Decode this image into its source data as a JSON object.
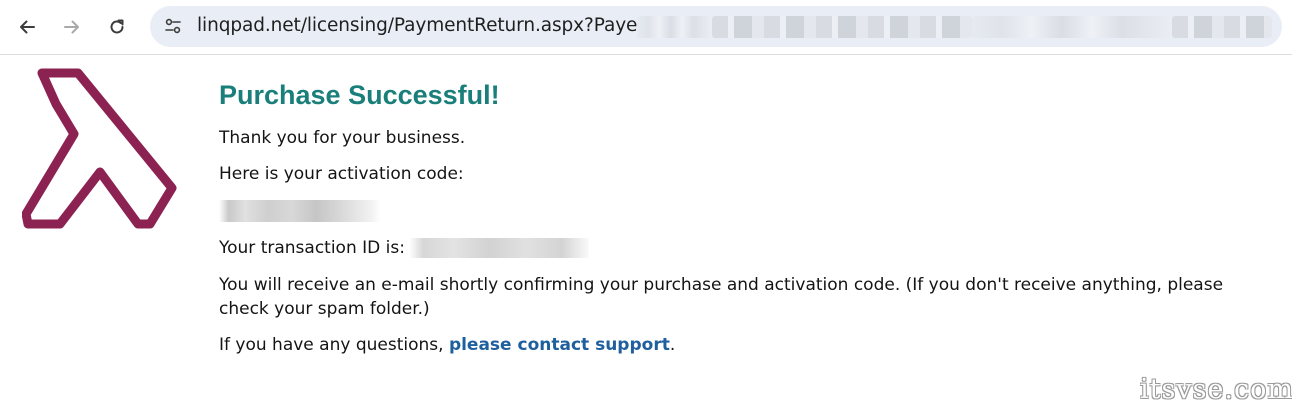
{
  "browser": {
    "back_icon": "arrow-left-icon",
    "forward_icon": "arrow-right-icon",
    "reload_icon": "reload-icon",
    "site_info_icon": "tune-icon",
    "url_visible": "linqpad.net/licensing/PaymentReturn.aspx?PayerID="
  },
  "page": {
    "logo_icon": "lambda-logo-icon",
    "title": "Purchase Successful!",
    "thanks": "Thank you for your business.",
    "activation_label": "Here is your activation code:",
    "transaction_label": "Your transaction ID is:",
    "email_notice": "You will receive an e-mail shortly confirming your purchase and activation code. (If you don't receive anything, please check your spam folder.)",
    "questions_prefix": "If you have any questions, ",
    "support_link": "please contact support",
    "questions_suffix": "."
  },
  "watermark": "itsvse.com",
  "colors": {
    "title": "#1a7f7a",
    "link": "#1f5f9e",
    "logo": "#8b2252",
    "omnibox": "#e9eef6"
  }
}
